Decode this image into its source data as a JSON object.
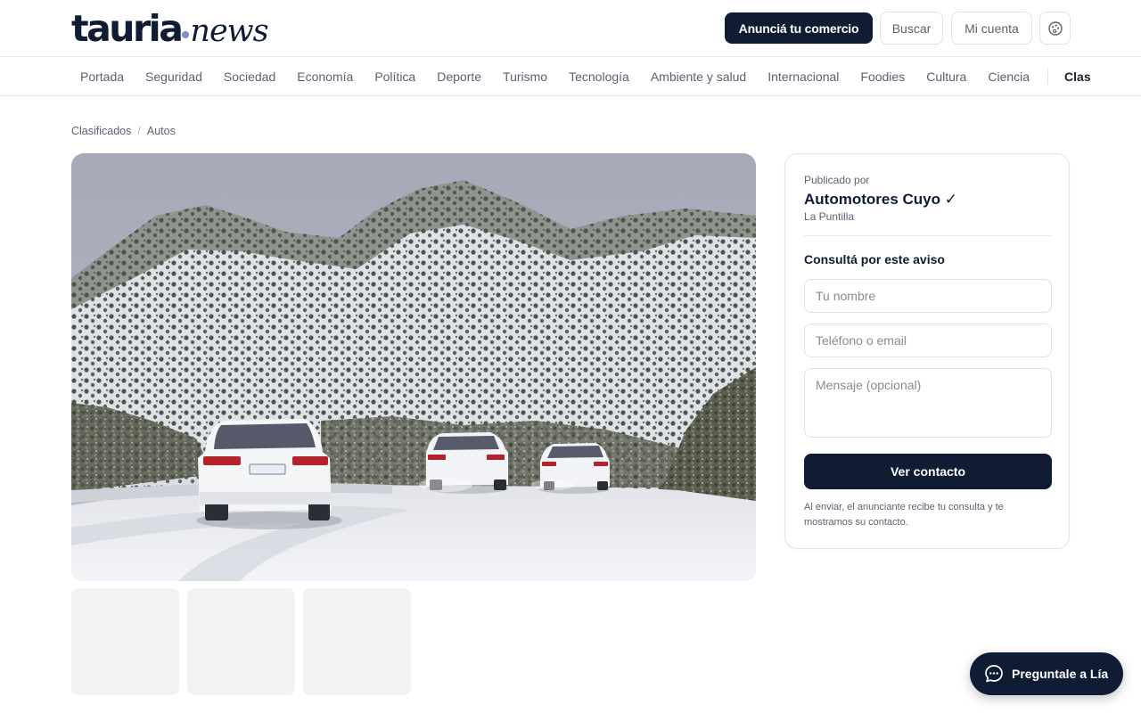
{
  "header": {
    "logo_main": "tauria",
    "logo_suffix": "news",
    "cta_label": "Anunciá tu comercio",
    "search_label": "Buscar",
    "account_label": "Mi cuenta",
    "theme_icon": "palette-icon"
  },
  "nav": {
    "items": [
      "Portada",
      "Seguridad",
      "Sociedad",
      "Economía",
      "Política",
      "Deporte",
      "Turismo",
      "Tecnología",
      "Ambiente y salud",
      "Internacional",
      "Foodies",
      "Cultura",
      "Ciencia"
    ],
    "highlight": "Clas"
  },
  "breadcrumb": {
    "items": [
      "Clasificados",
      "Autos"
    ],
    "separator": "/"
  },
  "listing": {
    "photo": "snowy-mountain-road-with-cars",
    "thumbnail_count": 3
  },
  "contact_card": {
    "published_by_label": "Publicado por",
    "seller_name": "Automotores Cuyo ✓",
    "seller_location": "La Puntilla",
    "inquiry_title": "Consultá por este aviso",
    "name_placeholder": "Tu nombre",
    "contact_placeholder": "Teléfono o email",
    "message_placeholder": "Mensaje (opcional)",
    "submit_label": "Ver contacto",
    "disclaimer": "Al enviar, el anunciante recibe tu consulta y te mostramos su contacto."
  },
  "chat": {
    "label": "Preguntale a Lía",
    "icon": "chat-bubble-icon"
  },
  "colors": {
    "brand_navy": "#0f1c33",
    "logo_dot": "#7b8fc8",
    "border": "#e6e8eb",
    "muted_text": "#5b6270",
    "thumb_placeholder": "#f1f2f3"
  }
}
